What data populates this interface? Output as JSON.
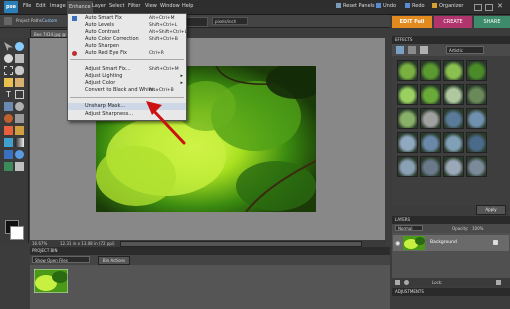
{
  "app": {
    "logo": "pse"
  },
  "menubar": {
    "items": [
      "File",
      "Edit",
      "Image",
      "Enhance",
      "Layer",
      "Select",
      "Filter",
      "View",
      "Window",
      "Help"
    ],
    "active": "Enhance",
    "right": {
      "reset_panels": "Reset Panels",
      "undo": "Undo",
      "redo": "Redo",
      "organizer": "Organizer"
    }
  },
  "options_bar": {
    "project_label": "Project Paths",
    "custom_value": "Custom",
    "preset": "pixels/inch"
  },
  "mode_tabs": {
    "edit": "EDIT Full",
    "create": "CREATE",
    "share": "SHARE"
  },
  "document": {
    "tab_title": "Bee 7434.jpg @ 16.7%",
    "zoom": "16.67%",
    "info": "12.31 in x 13.08 in (72 ppi)"
  },
  "enhance_menu": {
    "group1": [
      {
        "label": "Auto Smart Fix",
        "shortcut": "Alt+Ctrl+M"
      },
      {
        "label": "Auto Levels",
        "shortcut": "Shift+Ctrl+L"
      },
      {
        "label": "Auto Contrast",
        "shortcut": "Alt+Shift+Ctrl+L"
      },
      {
        "label": "Auto Color Correction",
        "shortcut": "Shift+Ctrl+B"
      },
      {
        "label": "Auto Sharpen",
        "shortcut": ""
      },
      {
        "label": "Auto Red Eye Fix",
        "shortcut": "Ctrl+R"
      }
    ],
    "group2": [
      {
        "label": "Adjust Smart Fix...",
        "shortcut": "Shift+Ctrl+M"
      },
      {
        "label": "Adjust Lighting",
        "shortcut": ""
      },
      {
        "label": "Adjust Color",
        "shortcut": ""
      },
      {
        "label": "Convert to Black and White...",
        "shortcut": "Alt+Ctrl+B"
      }
    ],
    "group3": [
      {
        "label": "Unsharp Mask...",
        "shortcut": ""
      },
      {
        "label": "Adjust Sharpness...",
        "shortcut": ""
      }
    ]
  },
  "project_bin": {
    "title": "PROJECT BIN",
    "show_value": "Show Open Files",
    "bin_actions": "Bin Actions"
  },
  "effects": {
    "title": "EFFECTS",
    "filter_value": "Artistic",
    "apply_label": "Apply"
  },
  "layers": {
    "title": "LAYERS",
    "blend_mode": "Normal",
    "opacity_label": "Opacity:",
    "opacity_value": "100%",
    "lock_label": "Lock:",
    "layer_name": "Background"
  },
  "adjustments": {
    "title": "ADJUSTMENTS"
  },
  "colors": {
    "edit_tab": "#e28a1e",
    "create_tab": "#b0356c",
    "share_tab": "#3d8b6a",
    "arrow": "#cc1111"
  }
}
